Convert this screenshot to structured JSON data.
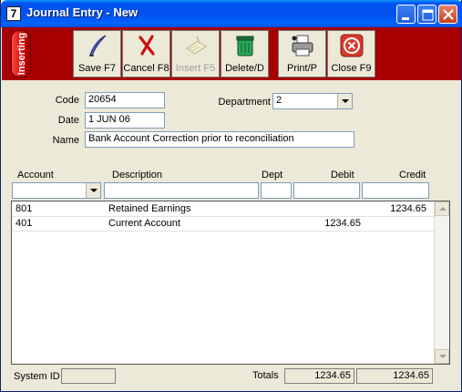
{
  "window": {
    "title": "Journal Entry - New",
    "icon_text": "7"
  },
  "toolbar": {
    "mode_badge": "Inserting",
    "buttons": [
      {
        "label": "Save F7",
        "icon": "quill-pen-icon",
        "enabled": true
      },
      {
        "label": "Cancel F8",
        "icon": "red-x-icon",
        "enabled": true
      },
      {
        "label": "Insert F5",
        "icon": "insert-doc-icon",
        "enabled": false
      },
      {
        "label": "Delete/D",
        "icon": "trash-bin-icon",
        "enabled": true
      },
      {
        "label": "Print/P",
        "icon": "printer-icon",
        "enabled": true
      },
      {
        "label": "Close F9",
        "icon": "close-circle-icon",
        "enabled": true
      }
    ],
    "background": "#a80000"
  },
  "form": {
    "code_label": "Code",
    "code_value": "20654",
    "date_label": "Date",
    "date_value": "1 JUN 06",
    "name_label": "Name",
    "name_value": "Bank Account Correction prior to reconciliation",
    "department_label": "Department",
    "department_value": "2"
  },
  "grid": {
    "columns": {
      "account": "Account",
      "description": "Description",
      "dept": "Dept",
      "debit": "Debit",
      "credit": "Credit"
    },
    "rows": [
      {
        "account": "801",
        "description": "Retained Earnings",
        "dept": "",
        "debit": "",
        "credit": "1234.65"
      },
      {
        "account": "401",
        "description": "Current Account",
        "dept": "",
        "debit": "1234.65",
        "credit": ""
      }
    ]
  },
  "footer": {
    "system_id_label": "System ID",
    "system_id_value": "",
    "totals_label": "Totals",
    "total_debit": "1234.65",
    "total_credit": "1234.65"
  }
}
